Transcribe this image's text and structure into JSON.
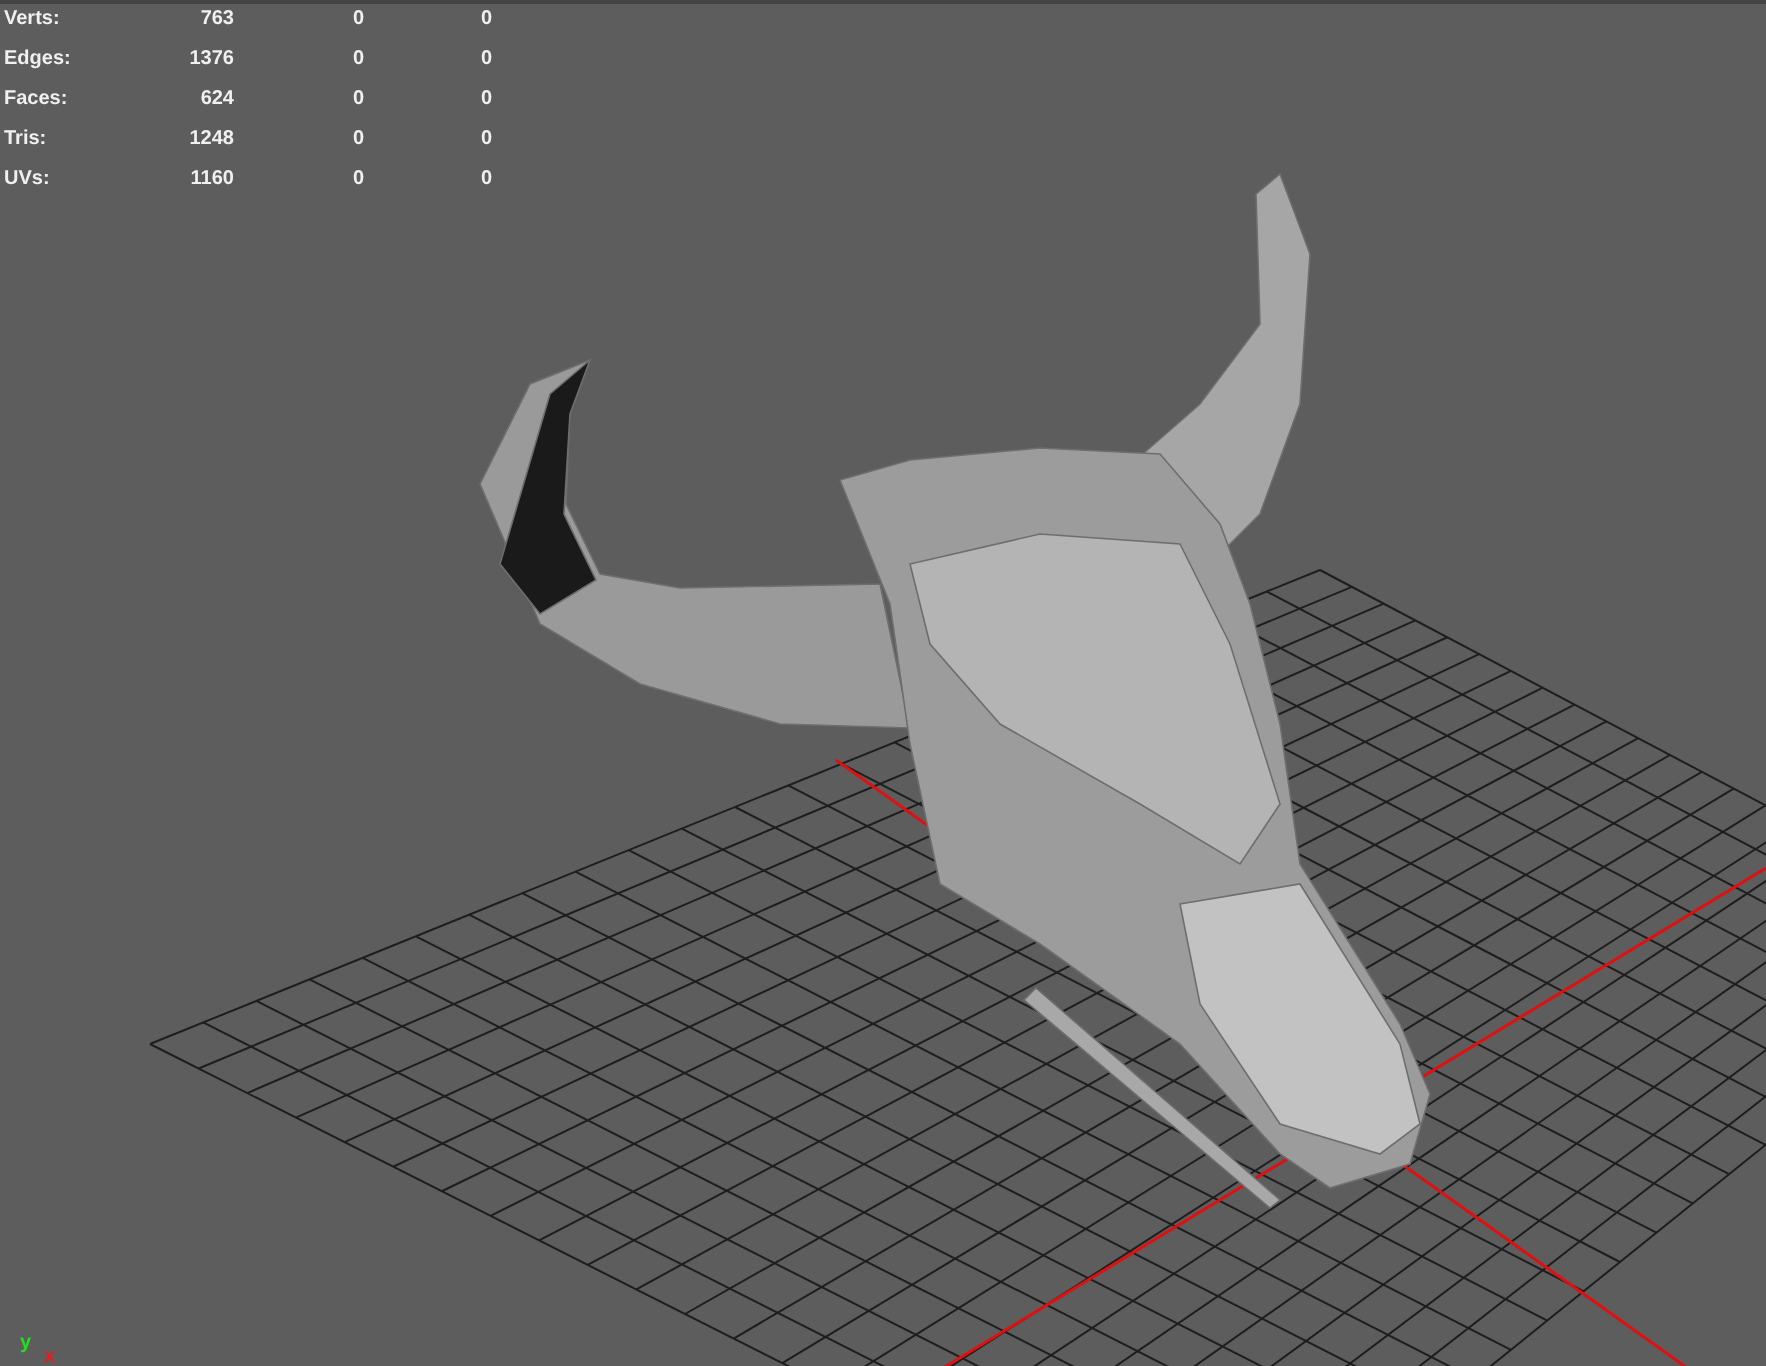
{
  "stats": [
    {
      "label": "Verts:",
      "values": [
        "763",
        "0",
        "0"
      ]
    },
    {
      "label": "Edges:",
      "values": [
        "1376",
        "0",
        "0"
      ]
    },
    {
      "label": "Faces:",
      "values": [
        "624",
        "0",
        "0"
      ]
    },
    {
      "label": "Tris:",
      "values": [
        "1248",
        "0",
        "0"
      ]
    },
    {
      "label": "UVs:",
      "values": [
        "1160",
        "0",
        "0"
      ]
    }
  ],
  "axis_gizmo": {
    "y_label": "y",
    "x_label": "x"
  }
}
